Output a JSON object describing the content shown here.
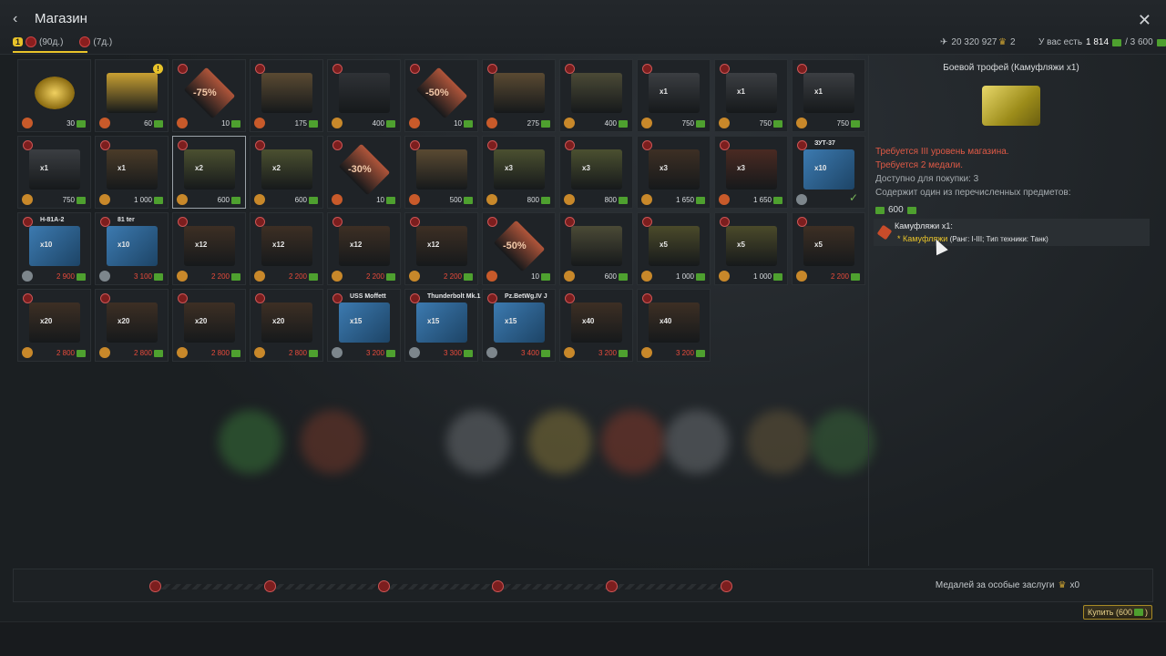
{
  "header": {
    "back_icon": "chevron-left-icon",
    "title": "Магазин",
    "close_icon": "close-icon",
    "tabs": [
      {
        "label": "(90д.)",
        "badge": "1"
      },
      {
        "label": "(7д.)"
      }
    ],
    "silver_lions": "20 320 927",
    "medals_count": "2",
    "balance_label": "У вас есть",
    "balance_value": "1 814",
    "balance_total": "/ 3 600"
  },
  "grid": {
    "rows": [
      [
        {
          "kind": "emblem",
          "price": "30",
          "color": "#c9a032",
          "locked": false
        },
        {
          "kind": "card",
          "price": "60",
          "color": "#c9a032",
          "locked": false,
          "alert": true
        },
        {
          "kind": "coupon",
          "label": "-75%",
          "price": "10",
          "color": "#b0553a",
          "locked": true
        },
        {
          "kind": "card",
          "price": "175",
          "color": "#5a4a32",
          "locked": true
        },
        {
          "kind": "crate-dark",
          "price": "400",
          "color": "#2f3236",
          "locked": true
        },
        {
          "kind": "coupon",
          "label": "-50%",
          "price": "10",
          "color": "#b0553a",
          "locked": true
        },
        {
          "kind": "card",
          "price": "275",
          "color": "#5a4a32",
          "locked": true
        },
        {
          "kind": "crate-olive",
          "price": "400",
          "color": "#4b4a36",
          "locked": true
        },
        {
          "kind": "crate-gray",
          "mult": "x1",
          "price": "750",
          "color": "#3b3e42",
          "locked": true
        },
        {
          "kind": "crate-gray",
          "mult": "x1",
          "price": "750",
          "color": "#3b3e42",
          "locked": true
        },
        {
          "kind": "crate-gray",
          "mult": "x1",
          "price": "750",
          "color": "#3b3e42",
          "locked": true
        }
      ],
      [
        {
          "kind": "crate-gray",
          "mult": "x1",
          "price": "750",
          "color": "#3b3e42",
          "locked": true
        },
        {
          "kind": "crate-brown",
          "mult": "x1",
          "price": "1 000",
          "color": "#4a3b28",
          "locked": true
        },
        {
          "kind": "crate-olive",
          "mult": "x2",
          "price": "600",
          "color": "#4b5030",
          "locked": true,
          "selected": true
        },
        {
          "kind": "crate-olive",
          "mult": "x2",
          "price": "600",
          "color": "#4b5030",
          "locked": true
        },
        {
          "kind": "coupon",
          "label": "-30%",
          "price": "10",
          "color": "#b0553a",
          "locked": true
        },
        {
          "kind": "card",
          "price": "500",
          "color": "#5a4a32",
          "locked": true
        },
        {
          "kind": "crate-olive",
          "mult": "x3",
          "price": "800",
          "color": "#4b5030",
          "locked": true
        },
        {
          "kind": "crate-olive",
          "mult": "x3",
          "price": "800",
          "color": "#4b5030",
          "locked": true
        },
        {
          "kind": "crate-brown",
          "mult": "x3",
          "price": "1 650",
          "color": "#3d2f24",
          "locked": true
        },
        {
          "kind": "pinup",
          "mult": "x3",
          "price": "1 650",
          "color": "#4a2a22",
          "locked": true
        },
        {
          "kind": "blueprint",
          "name": "ЗУТ-37",
          "mult": "x10",
          "price": "",
          "color": "#2a5c88",
          "locked": true,
          "owned": true
        }
      ],
      [
        {
          "kind": "blueprint",
          "name": "H-81A-2",
          "mult": "x10",
          "price": "2 900",
          "color": "#2a5c88",
          "locked": true,
          "red": true
        },
        {
          "kind": "blueprint",
          "name": "81 ter",
          "mult": "x10",
          "price": "3 100",
          "color": "#2a5c88",
          "locked": true,
          "red": true
        },
        {
          "kind": "crate-brown",
          "mult": "x12",
          "price": "2 200",
          "color": "#3d2f24",
          "locked": true,
          "red": true
        },
        {
          "kind": "crate-brown",
          "mult": "x12",
          "price": "2 200",
          "color": "#3d2f24",
          "locked": true,
          "red": true
        },
        {
          "kind": "crate-brown",
          "mult": "x12",
          "price": "2 200",
          "color": "#3d2f24",
          "locked": true,
          "red": true
        },
        {
          "kind": "crate-brown",
          "mult": "x12",
          "price": "2 200",
          "color": "#3d2f24",
          "locked": true,
          "red": true
        },
        {
          "kind": "coupon",
          "label": "-50%",
          "price": "10",
          "color": "#b0553a",
          "locked": true
        },
        {
          "kind": "crate-olive",
          "price": "600",
          "color": "#4b4a36",
          "locked": true
        },
        {
          "kind": "crate-olive",
          "mult": "x5",
          "price": "1 000",
          "color": "#4b4a2a",
          "locked": true
        },
        {
          "kind": "crate-olive",
          "mult": "x5",
          "price": "1 000",
          "color": "#4b4a2a",
          "locked": true
        },
        {
          "kind": "crate-brown",
          "mult": "x5",
          "price": "2 200",
          "color": "#3d2f24",
          "locked": true,
          "red": true
        }
      ],
      [
        {
          "kind": "crate-brown",
          "mult": "x20",
          "price": "2 800",
          "color": "#3d2f24",
          "locked": true,
          "red": true
        },
        {
          "kind": "crate-brown",
          "mult": "x20",
          "price": "2 800",
          "color": "#3d2f24",
          "locked": true,
          "red": true
        },
        {
          "kind": "crate-brown",
          "mult": "x20",
          "price": "2 800",
          "color": "#3d2f24",
          "locked": true,
          "red": true
        },
        {
          "kind": "crate-brown",
          "mult": "x20",
          "price": "2 800",
          "color": "#3d2f24",
          "locked": true,
          "red": true
        },
        {
          "kind": "blueprint",
          "name": "USS Moffett",
          "mult": "x15",
          "price": "3 200",
          "color": "#2a5c88",
          "locked": true,
          "red": true
        },
        {
          "kind": "blueprint",
          "name": "Thunderbolt Mk.1",
          "mult": "x15",
          "price": "3 300",
          "color": "#2a5c88",
          "locked": true,
          "red": true
        },
        {
          "kind": "blueprint",
          "name": "Pz.BetWg.IV J",
          "mult": "x15",
          "price": "3 400",
          "color": "#2a5c88",
          "locked": true,
          "red": true
        },
        {
          "kind": "crate-brown",
          "mult": "x40",
          "price": "3 200",
          "color": "#3d2f24",
          "locked": true,
          "red": true
        },
        {
          "kind": "crate-brown",
          "mult": "x40",
          "price": "3 200",
          "color": "#3d2f24",
          "locked": true,
          "red": true
        }
      ]
    ]
  },
  "side": {
    "title": "Боевой трофей (Камуфляжи x1)",
    "req1": "Требуется III уровень магазина.",
    "req2": "Требуется 2 медали.",
    "available": "Доступно для покупки: 3",
    "contains": "Содержит один из перечисленных предметов:",
    "price": "600",
    "item_title": "Камуфляжи x1:",
    "item_name": "* Камуфляжи",
    "item_detail": "(Ранг: I-III; Тип техники: Танк)"
  },
  "footer": {
    "medals_label": "Медалей за особые заслуги",
    "medals_value": "x0",
    "buy_label": "Купить (600",
    "buy_suffix": ")"
  }
}
